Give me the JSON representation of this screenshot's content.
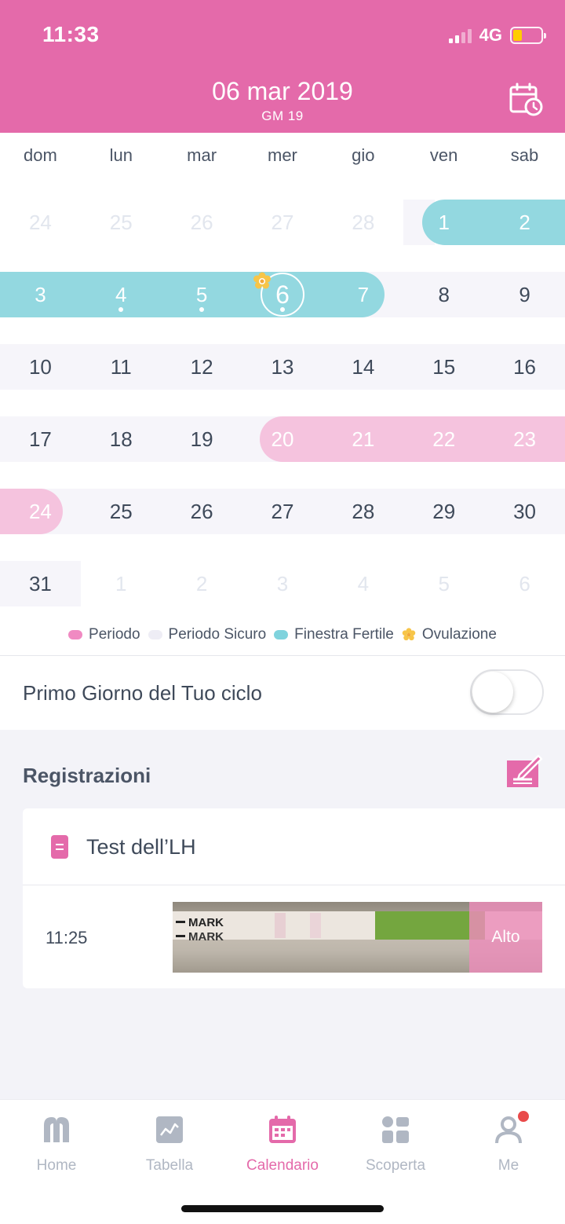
{
  "status": {
    "time": "11:33",
    "network": "4G"
  },
  "header": {
    "date": "06 mar 2019",
    "cycle_day": "GM 19",
    "calendar_icon": "calendar-clock-icon"
  },
  "weekdays": [
    "dom",
    "lun",
    "mar",
    "mer",
    "gio",
    "ven",
    "sab"
  ],
  "calendar": {
    "weeks": [
      [
        "24",
        "25",
        "26",
        "27",
        "28",
        "1",
        "2"
      ],
      [
        "3",
        "4",
        "5",
        "6",
        "7",
        "8",
        "9"
      ],
      [
        "10",
        "11",
        "12",
        "13",
        "14",
        "15",
        "16"
      ],
      [
        "17",
        "18",
        "19",
        "20",
        "21",
        "22",
        "23"
      ],
      [
        "24",
        "25",
        "26",
        "27",
        "28",
        "29",
        "30"
      ],
      [
        "31",
        "1",
        "2",
        "3",
        "4",
        "5",
        "6"
      ]
    ]
  },
  "legend": {
    "period": "Periodo",
    "safe": "Periodo Sicuro",
    "fertile": "Finestra Fertile",
    "ovulation": "Ovulazione"
  },
  "colors": {
    "accent": "#e46aaa",
    "fertile": "#93d8e0",
    "period": "#f5c3de",
    "safe": "#f6f5fa"
  },
  "toggle": {
    "label": "Primo Giorno del Tuo ciclo",
    "on": false
  },
  "records": {
    "title": "Registrazioni",
    "card_title": "Test dell’LH",
    "entry_time": "11:25",
    "strip_text_1": "MARK",
    "strip_text_2": "MARK",
    "result": "Alto"
  },
  "tabs": [
    {
      "label": "Home",
      "icon": "home-icon"
    },
    {
      "label": "Tabella",
      "icon": "chart-icon"
    },
    {
      "label": "Calendario",
      "icon": "calendar-icon",
      "active": true
    },
    {
      "label": "Scoperta",
      "icon": "discover-icon"
    },
    {
      "label": "Me",
      "icon": "profile-icon",
      "badge": true
    }
  ]
}
